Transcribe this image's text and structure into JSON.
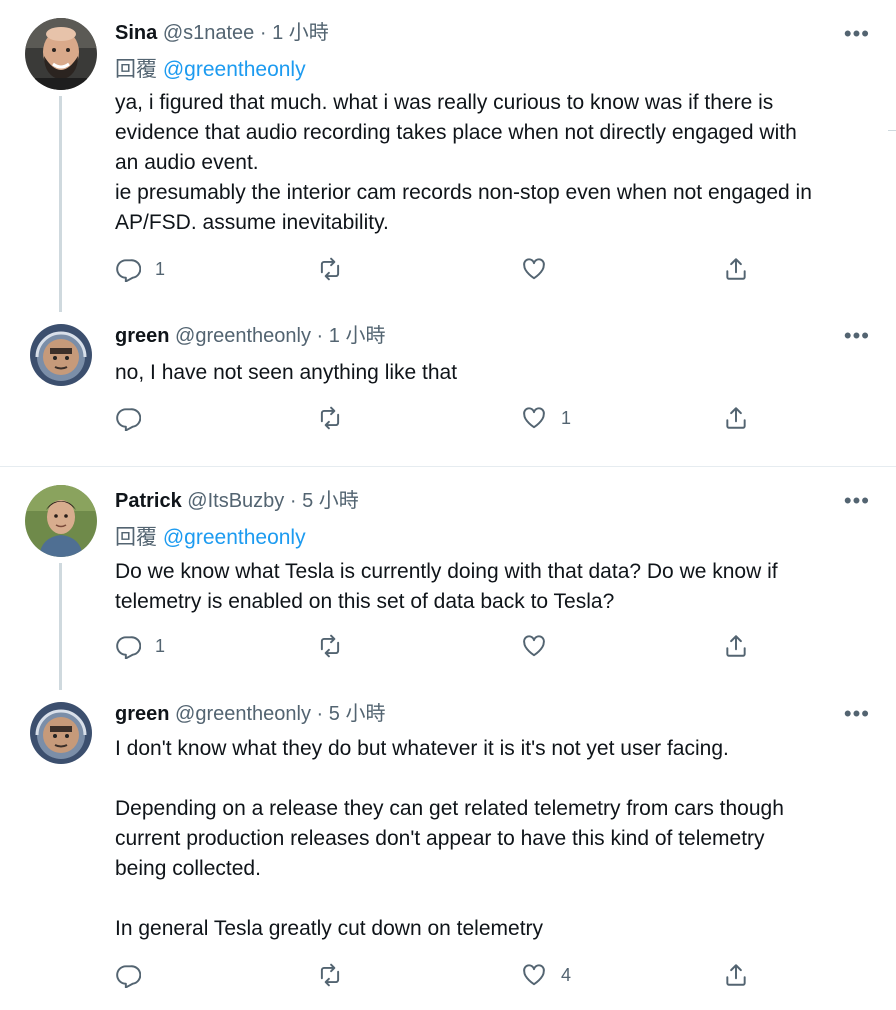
{
  "tweets": [
    {
      "name": "Sina",
      "handle": "@s1natee",
      "dot": "·",
      "time": "1 小時",
      "reply_prefix": "回覆",
      "reply_mention": "@greentheonly",
      "lines": [
        "ya, i figured that much. what i was really curious to know was if there is",
        "evidence that audio recording takes place when not directly engaged with",
        "an audio event.",
        "ie presumably the interior cam records non-stop even when not engaged in",
        "AP/FSD. assume inevitability."
      ],
      "reply_count": "1",
      "like_count": ""
    },
    {
      "name": "green",
      "handle": "@greentheonly",
      "dot": "·",
      "time": "1 小時",
      "lines": [
        "no, I have not seen anything like that"
      ],
      "reply_count": "",
      "like_count": "1"
    },
    {
      "name": "Patrick",
      "handle": "@ItsBuzby",
      "dot": "·",
      "time": "5 小時",
      "reply_prefix": "回覆",
      "reply_mention": "@greentheonly",
      "lines": [
        "Do we know what Tesla is currently doing with that data? Do we know if",
        "telemetry is enabled on this set of data back to Tesla?"
      ],
      "reply_count": "1",
      "like_count": ""
    },
    {
      "name": "green",
      "handle": "@greentheonly",
      "dot": "·",
      "time": "5 小時",
      "paragraphs": [
        [
          "I don't know what they do but whatever it is it's not yet user facing."
        ],
        [
          "Depending on a release they can get related telemetry from cars though",
          "current production releases don't appear to have this kind of telemetry",
          "being collected."
        ],
        [
          "In general Tesla greatly cut down on telemetry"
        ]
      ],
      "reply_count": "",
      "like_count": "4"
    }
  ],
  "more_label": "•••",
  "icons": {
    "reply": "reply-icon",
    "retweet": "retweet-icon",
    "like": "like-icon",
    "share": "share-icon"
  },
  "colors": {
    "link": "#1d9bf0",
    "muted": "#536471",
    "thread_line": "#cfd9de"
  }
}
